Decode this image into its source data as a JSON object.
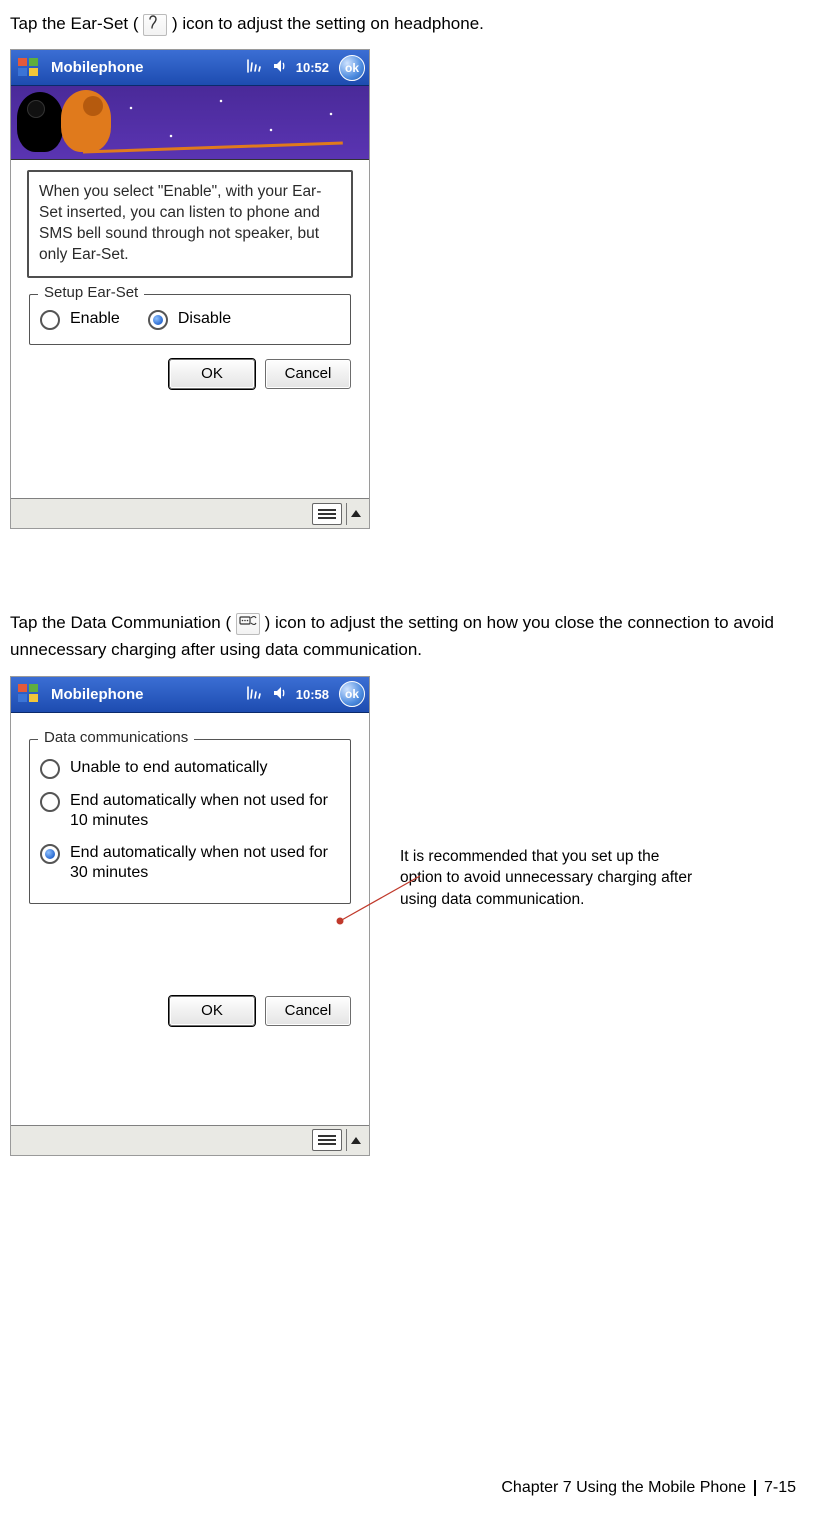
{
  "intro1_pre": "Tap the Ear-Set (",
  "intro1_post": ") icon to adjust the setting on headphone.",
  "intro2_pre": "Tap the Data Communiation (",
  "intro2_post": ") icon to adjust the setting on how you close the connection to avoid unnecessary charging after using data communication.",
  "shot1": {
    "title": "Mobilephone",
    "time": "10:52",
    "ok": "ok",
    "info": "When you select \"Enable\", with your Ear-Set inserted, you can listen to phone and SMS bell sound through not speaker, but only Ear-Set.",
    "group_label": "Setup Ear-Set",
    "opt_enable": "Enable",
    "opt_disable": "Disable",
    "btn_ok": "OK",
    "btn_cancel": "Cancel"
  },
  "shot2": {
    "title": "Mobilephone",
    "time": "10:58",
    "ok": "ok",
    "group_label": "Data communications",
    "opt1": "Unable to end automatically",
    "opt2": "End automatically when not used for 10 minutes",
    "opt3": "End automatically when not used for 30 minutes",
    "btn_ok": "OK",
    "btn_cancel": "Cancel"
  },
  "annotation": "It is recommended that you set up the option to avoid unnecessary charging after using data communication.",
  "footer_chapter": "Chapter 7 Using the Mobile Phone",
  "footer_page": "7-15"
}
